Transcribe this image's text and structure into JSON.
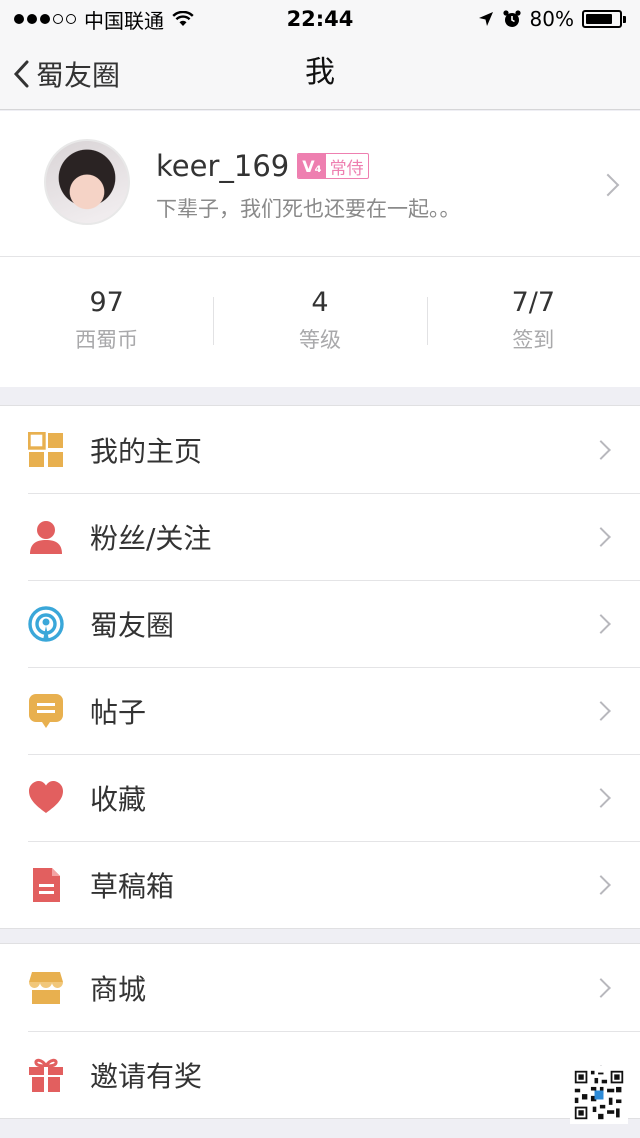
{
  "status_bar": {
    "carrier": "中国联通",
    "time": "22:44",
    "battery": "80%",
    "battery_level": 0.8
  },
  "nav": {
    "back_label": "蜀友圈",
    "title": "我"
  },
  "profile": {
    "name": "keer_169",
    "badge_v": "V₄",
    "badge_text": "常侍",
    "signature": "下辈子，我们死也还要在一起。。"
  },
  "stats": [
    {
      "value": "97",
      "label": "西蜀币"
    },
    {
      "value": "4",
      "label": "等级"
    },
    {
      "value": "7/7",
      "label": "签到"
    }
  ],
  "menu_group_1": [
    {
      "label": "我的主页",
      "icon": "grid-icon",
      "color": "#e8b04f"
    },
    {
      "label": "粉丝/关注",
      "icon": "person-icon",
      "color": "#e25f5f"
    },
    {
      "label": "蜀友圈",
      "icon": "broadcast-icon",
      "color": "#3aa7d9"
    },
    {
      "label": "帖子",
      "icon": "post-icon",
      "color": "#e8b04f"
    },
    {
      "label": "收藏",
      "icon": "heart-icon",
      "color": "#e25f5f"
    },
    {
      "label": "草稿箱",
      "icon": "draft-icon",
      "color": "#e25f5f"
    }
  ],
  "menu_group_2": [
    {
      "label": "商城",
      "icon": "shop-icon",
      "color": "#e8b04f"
    },
    {
      "label": "邀请有奖",
      "icon": "gift-icon",
      "color": "#e25f5f"
    }
  ]
}
